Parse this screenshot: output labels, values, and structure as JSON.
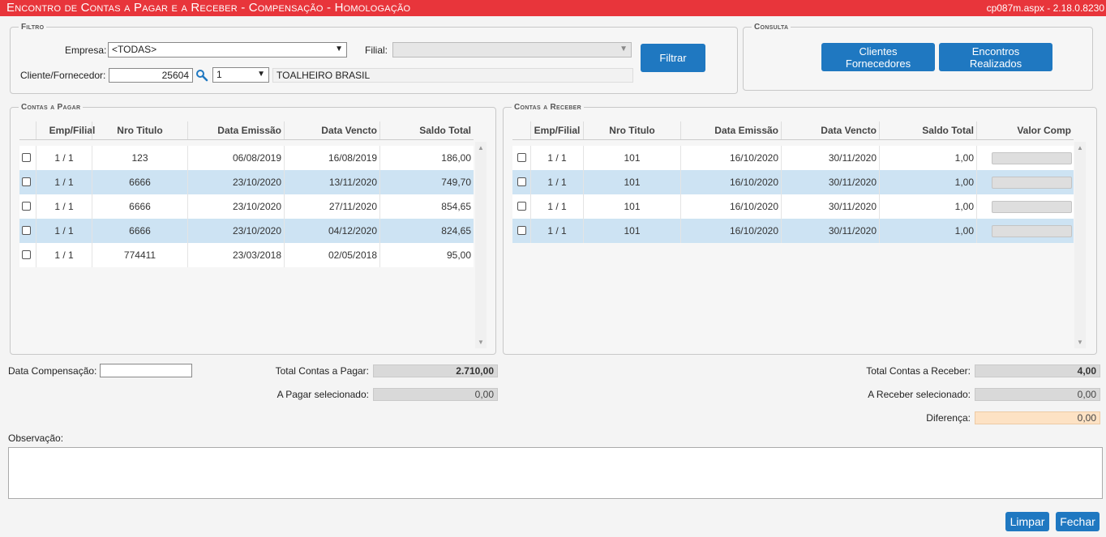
{
  "title": "Encontro de Contas a Pagar e a Receber - Compensação  - Homologação",
  "version": "cp087m.aspx - 2.18.0.8230",
  "filtro": {
    "legend": "Filtro",
    "empresa_label": "Empresa:",
    "empresa_value": "<TODAS>",
    "filial_label": "Filial:",
    "filial_value": "",
    "cliente_label": "Cliente/Fornecedor:",
    "cliente_code": "25604",
    "cliente_type": "1",
    "cliente_name": "TOALHEIRO BRASIL",
    "filtrar_button": "Filtrar"
  },
  "consulta": {
    "legend": "Consulta",
    "clientes_button_line1": "Clientes",
    "clientes_button_line2": "Fornecedores",
    "encontros_button_line1": "Encontros",
    "encontros_button_line2": "Realizados"
  },
  "pagar": {
    "legend": "Contas a Pagar",
    "headers": [
      "Emp/Filial",
      "Nro Titulo",
      "Data Emissão",
      "Data Vencto",
      "Saldo Total"
    ],
    "rows": [
      {
        "emp": "1 / 1",
        "nro": "123",
        "emissao": "06/08/2019",
        "vencto": "16/08/2019",
        "saldo": "186,00"
      },
      {
        "emp": "1 / 1",
        "nro": "6666",
        "emissao": "23/10/2020",
        "vencto": "13/11/2020",
        "saldo": "749,70"
      },
      {
        "emp": "1 / 1",
        "nro": "6666",
        "emissao": "23/10/2020",
        "vencto": "27/11/2020",
        "saldo": "854,65"
      },
      {
        "emp": "1 / 1",
        "nro": "6666",
        "emissao": "23/10/2020",
        "vencto": "04/12/2020",
        "saldo": "824,65"
      },
      {
        "emp": "1 / 1",
        "nro": "774411",
        "emissao": "23/03/2018",
        "vencto": "02/05/2018",
        "saldo": "95,00"
      }
    ]
  },
  "receber": {
    "legend": "Contas a Receber",
    "headers": [
      "Emp/Filial",
      "Nro Titulo",
      "Data Emissão",
      "Data Vencto",
      "Saldo Total",
      "Valor Comp"
    ],
    "rows": [
      {
        "emp": "1 / 1",
        "nro": "101",
        "emissao": "16/10/2020",
        "vencto": "30/11/2020",
        "saldo": "1,00"
      },
      {
        "emp": "1 / 1",
        "nro": "101",
        "emissao": "16/10/2020",
        "vencto": "30/11/2020",
        "saldo": "1,00"
      },
      {
        "emp": "1 / 1",
        "nro": "101",
        "emissao": "16/10/2020",
        "vencto": "30/11/2020",
        "saldo": "1,00"
      },
      {
        "emp": "1 / 1",
        "nro": "101",
        "emissao": "16/10/2020",
        "vencto": "30/11/2020",
        "saldo": "1,00"
      }
    ]
  },
  "footer": {
    "data_comp_label": "Data Compensação:",
    "data_comp_value": "",
    "total_pagar_label": "Total Contas a Pagar:",
    "total_pagar_value": "2.710,00",
    "pagar_sel_label": "A Pagar selecionado:",
    "pagar_sel_value": "0,00",
    "total_receber_label": "Total Contas a Receber:",
    "total_receber_value": "4,00",
    "receber_sel_label": "A Receber selecionado:",
    "receber_sel_value": "0,00",
    "diferenca_label": "Diferença:",
    "diferenca_value": "0,00",
    "observacao_label": "Observação:",
    "observacao_value": "",
    "limpar_button": "Limpar",
    "fechar_button": "Fechar"
  },
  "colors": {
    "title_bar": "#e8353b",
    "button": "#1f78c1",
    "row_highlight": "#cde3f3",
    "diferenca_bg": "#fde2c4"
  },
  "icons": {
    "search": "magnifier-icon",
    "dropdown": "chevron-down-icon",
    "scroll": "scroll-arrow-icon"
  }
}
